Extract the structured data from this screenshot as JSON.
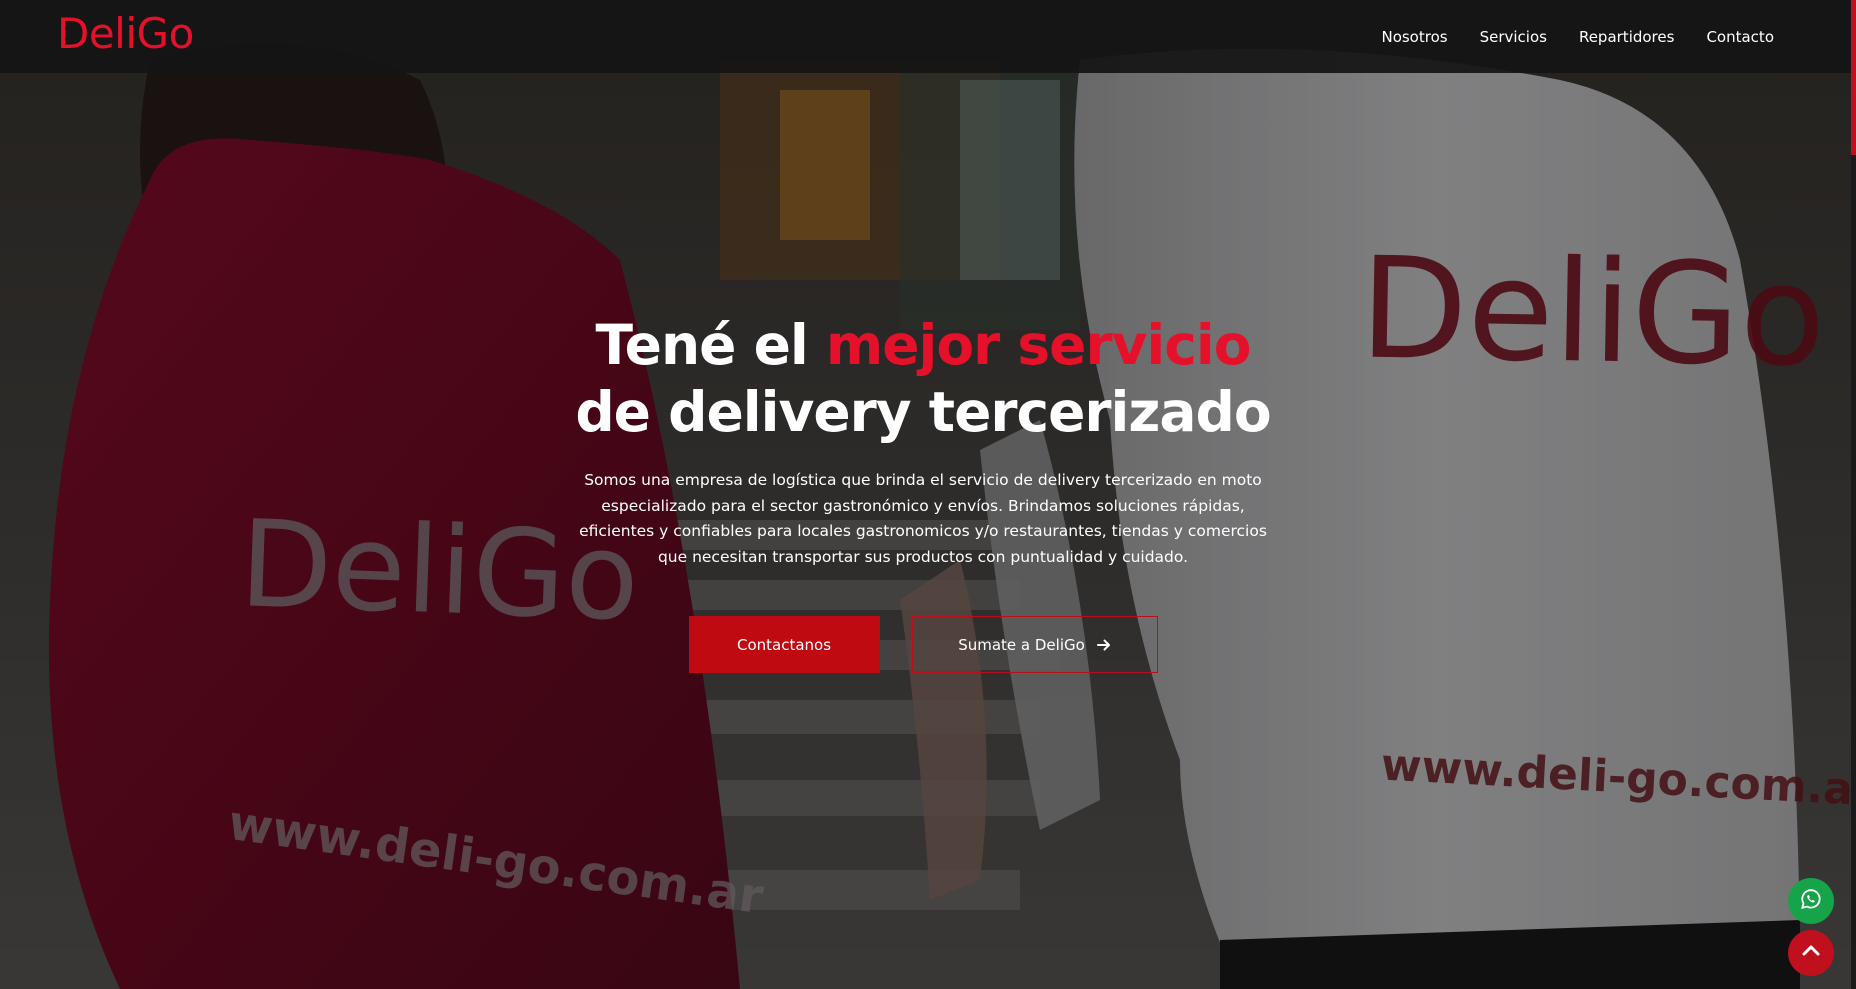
{
  "brand": {
    "name": "DeliGo"
  },
  "nav": {
    "items": [
      {
        "label": "Nosotros"
      },
      {
        "label": "Servicios"
      },
      {
        "label": "Repartidores"
      },
      {
        "label": "Contacto"
      }
    ]
  },
  "hero": {
    "title_line1_prefix": "Tené el",
    "title_line1_accent": "mejor servicio",
    "title_line2": "de delivery tercerizado",
    "description": "Somos una empresa de logística que brinda el servicio de delivery tercerizado en moto especializado para el sector gastronómico y envíos. Brindamos soluciones rápidas, eficientes y confiables para locales gastronomicos y/o restaurantes, tiendas y comercios que necesitan transportar sus productos con puntualidad y cuidado.",
    "primary_button": "Contactanos",
    "secondary_button": "Sumate a DeliGo",
    "background_shirt_texts": {
      "left_brand": "DeliGo",
      "left_url": "www.deli-go.com.ar",
      "right_brand": "DeliGo",
      "right_url": "www.deli-go.com.ar"
    }
  },
  "icons": {
    "whatsapp": "whatsapp-icon",
    "back_to_top": "chevron-up-icon",
    "arrow": "arrow-right-icon"
  },
  "colors": {
    "accent": "#e5112a",
    "primary_button": "#bf0a12",
    "whatsapp": "#16a34a",
    "back_to_top": "#c0101d",
    "navbar": "#141414"
  }
}
